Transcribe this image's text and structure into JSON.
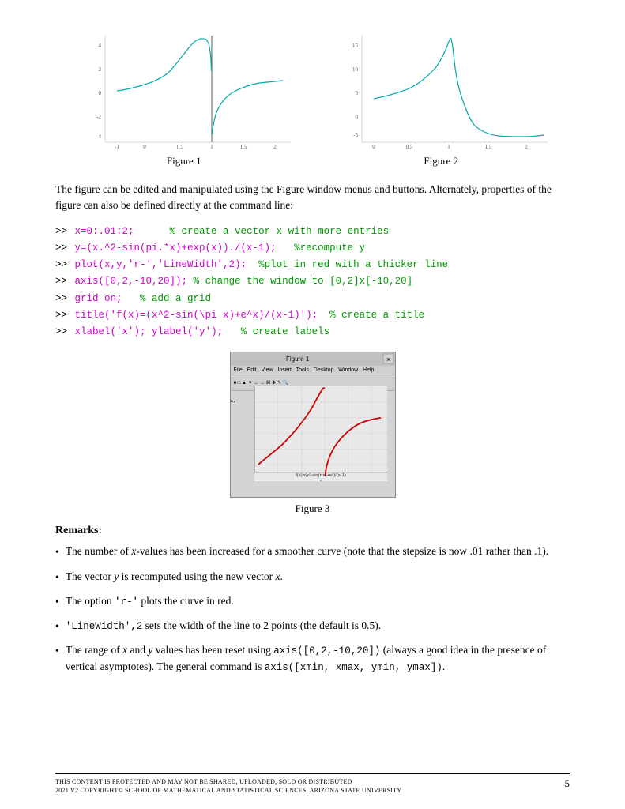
{
  "figures": {
    "figure1_caption": "Figure 1",
    "figure2_caption": "Figure 2",
    "figure3_caption": "Figure 3"
  },
  "description": {
    "text": "The figure can be edited and manipulated using the Figure window menus and buttons. Alternately, properties of the figure can also be defined directly at the command line:"
  },
  "code": {
    "lines": [
      {
        "prompt": ">>",
        "content": "x=0:.01:2;",
        "comment": "% create a vector x with more entries"
      },
      {
        "prompt": ">>",
        "content": "y=(x.^2-sin(pi.*x)+exp(x))./(x-1);",
        "comment": "%recompute y"
      },
      {
        "prompt": ">>",
        "content": "plot(x,y,'r-','LineWidth',2);",
        "comment": "%plot in red with a thicker line"
      },
      {
        "prompt": ">>",
        "content": "axis([0,2,-10,20]);",
        "comment": "% change the window to [0,2]x[-10,20]"
      },
      {
        "prompt": ">>",
        "content": "grid on;",
        "comment": "% add a grid"
      },
      {
        "prompt": ">>",
        "content": "title('f(x)=(x^2-sin(\\pi x)+e^x)/(x-1)');",
        "comment": "% create a title"
      },
      {
        "prompt": ">>",
        "content": "xlabel('x'); ylabel('y');",
        "comment": "% create labels"
      }
    ]
  },
  "remarks": {
    "title": "Remarks:",
    "bullets": [
      "The number of x-values has been increased for a smoother curve (note that the stepsize is now .01 rather than .1).",
      "The vector y is recomputed using the new vector x.",
      "The option 'r-' plots the curve in red.",
      "'LineWidth',2 sets the width of the line to 2 points (the default is 0.5).",
      "The range of x and y values has been reset using axis([0,2,-10,20]) (always a good idea in the presence of vertical asymptotes). The general command is axis([xmin, xmax, ymin, ymax])."
    ]
  },
  "footer": {
    "left_line1": "THIS CONTENT IS PROTECTED AND MAY NOT BE SHARED, UPLOADED, SOLD OR DISTRIBUTED",
    "left_line2": "2021 v2 Copyright© School of Mathematical and Statistical Sciences, Arizona State University",
    "page_number": "5"
  }
}
